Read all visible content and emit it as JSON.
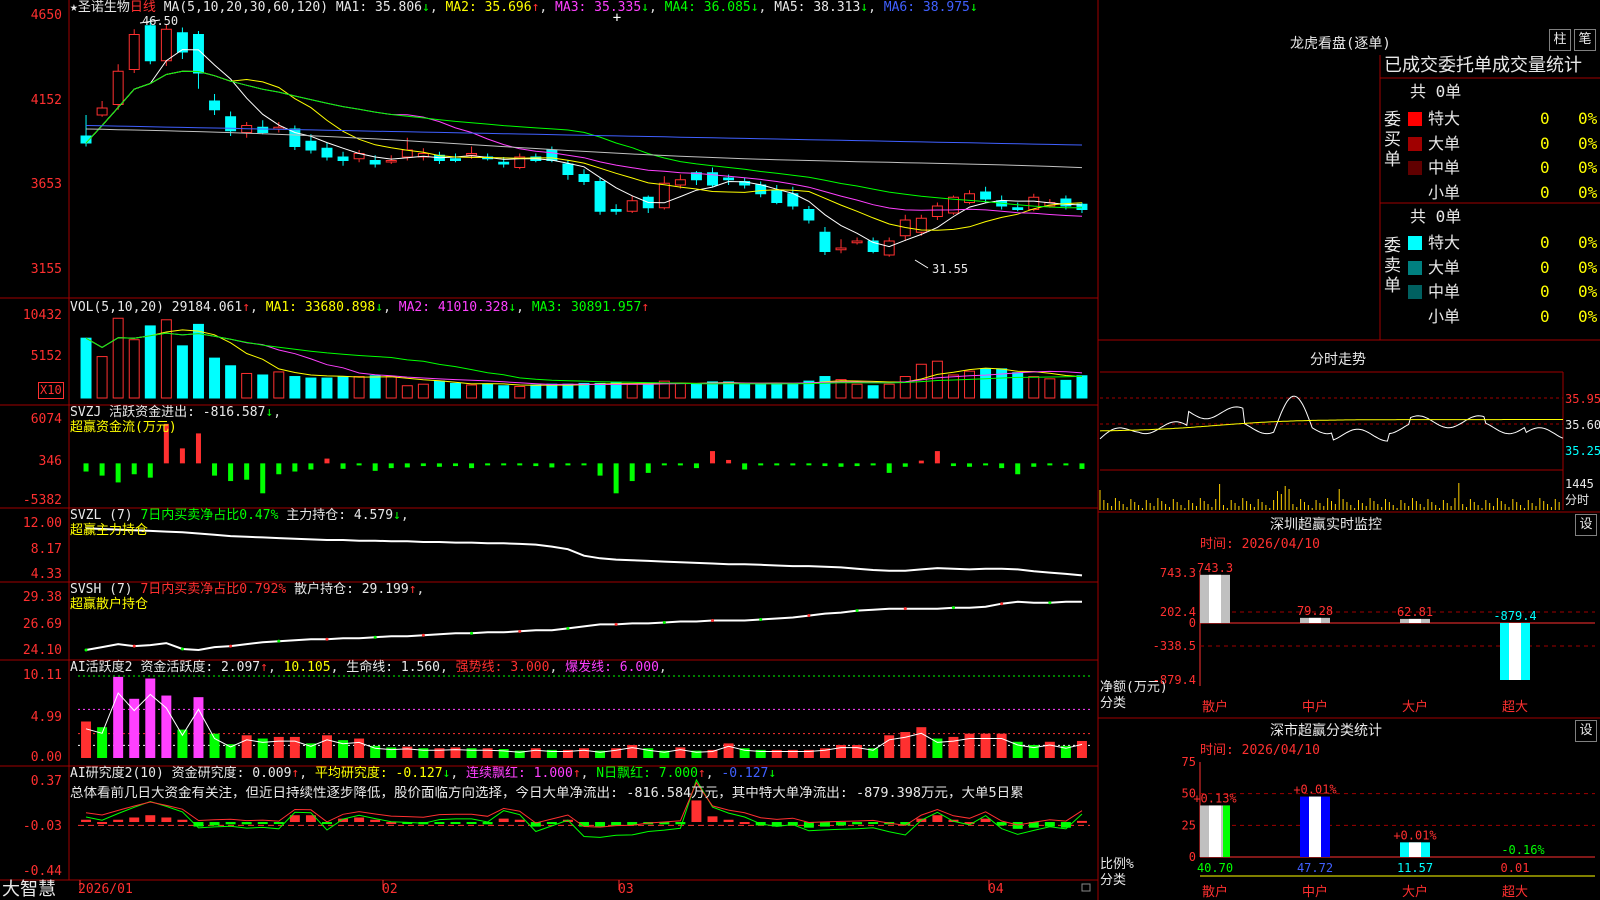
{
  "stock": {
    "name": "圣诺生物",
    "period": "日线",
    "star": "★"
  },
  "main_indicator": {
    "label": "MA(5,10,20,30,60,120)",
    "ma1": "MA1: 35.806",
    "ma2": "MA2: 35.696",
    "ma3": "MA3: 35.335",
    "ma4": "MA4: 36.085",
    "ma5": "MA5: 38.313",
    "ma6": "MA6: 38.975",
    "high_mark": "46.50",
    "low_mark": "31.55"
  },
  "vol_indicator": {
    "label": "VOL(5,10,20)",
    "value": "29184.061",
    "ma1": "MA1: 33680.898",
    "ma2": "MA2: 41010.328",
    "ma3": "MA3: 30891.957",
    "unit": "X10"
  },
  "svzj": {
    "label": "SVZJ",
    "line1": "活跃资金进出: -816.587",
    "line2": "超赢资金流(万元)"
  },
  "svzl": {
    "label": "SVZL (7)",
    "ratio": "7日内买卖净占比0.47%",
    "hold": "主力持仓: 4.579",
    "name": "超赢主力持仓"
  },
  "svsh": {
    "label": "SVSH (7)",
    "ratio": "7日内买卖净占比0.792%",
    "hold": "散户持仓: 29.199",
    "name": "超赢散户持仓"
  },
  "ai_active": {
    "label": "AI活跃度2",
    "act": "资金活跃度: 2.097",
    "v2": "10.105",
    "life": "生命线: 1.560",
    "strong": "强势线: 3.000",
    "burst": "爆发线: 6.000"
  },
  "ai_research": {
    "label": "AI研究度2(10)",
    "res": "资金研究度: 0.009",
    "avg": "平均研究度: -0.127",
    "red": "连续飘红: 1.000",
    "nred": "N日飘红: 7.000",
    "last": "-0.127"
  },
  "commentary": "总体看前几日大资金有关注，但近日持续性逐步降低，股价面临方向选择，今日大单净流出: -816.584万元，其中特大单净流出: -879.398万元，大单5日累",
  "axes": {
    "main": [
      "4650",
      "4152",
      "3653",
      "3155"
    ],
    "vol": [
      "10432",
      "5152"
    ],
    "svzj": [
      "6074",
      "346",
      "-5382"
    ],
    "svzl": [
      "12.00",
      "8.17",
      "4.33"
    ],
    "svsh": [
      "29.38",
      "26.69",
      "24.10"
    ],
    "ai1": [
      "10.11",
      "4.99",
      "0.00"
    ],
    "ai2": [
      "0.37",
      "-0.03",
      "-0.44"
    ],
    "dates": [
      "2026/01",
      "02",
      "03",
      "04"
    ]
  },
  "brand": "大智慧",
  "right": {
    "dragon_title": "龙虎看盘(逐单)",
    "btn_bar": "柱",
    "btn_pen": "笔",
    "stats_header": "已成交委托单成交量统计",
    "buy_label": "委买单",
    "sell_label": "委卖单",
    "buy_total": "共 0单",
    "sell_total": "共 0单",
    "buy_rows": [
      {
        "name": "特大",
        "count": "0",
        "pct": "0%",
        "color": "#ff0000"
      },
      {
        "name": "大单",
        "count": "0",
        "pct": "0%",
        "color": "#a00000"
      },
      {
        "name": "中单",
        "count": "0",
        "pct": "0%",
        "color": "#600000"
      },
      {
        "name": "小单",
        "count": "0",
        "pct": "0%",
        "color": "#000000"
      }
    ],
    "sell_rows": [
      {
        "name": "特大",
        "count": "0",
        "pct": "0%",
        "color": "#00ffff"
      },
      {
        "name": "大单",
        "count": "0",
        "pct": "0%",
        "color": "#008080"
      },
      {
        "name": "中单",
        "count": "0",
        "pct": "0%",
        "color": "#006060"
      },
      {
        "name": "小单",
        "count": "0",
        "pct": "0%",
        "color": "#000000"
      }
    ],
    "intraday_title": "分时走势",
    "intraday_prices": [
      "35.95",
      "35.60",
      "35.25"
    ],
    "intraday_vol": [
      "1445",
      "分时"
    ],
    "monitor_title": "深圳超赢实时监控",
    "monitor_time": "时间: 2026/04/10",
    "monitor_axis": [
      "743.3",
      "202.4",
      "0",
      "-338.5",
      "-879.4"
    ],
    "monitor_ylabel": "净额(万元)",
    "monitor_xlabel": "分类",
    "monitor_cats": [
      "散户",
      "中户",
      "大户",
      "超大"
    ],
    "monitor_values": [
      "743.3",
      "79.28",
      "62.81",
      "-879.4"
    ],
    "class_title": "深市超赢分类统计",
    "class_time": "时间: 2026/04/10",
    "class_axis": [
      "75",
      "50",
      "25",
      "0"
    ],
    "class_ylabel": "比例%",
    "class_xlabel": "分类",
    "class_cats": [
      "散户",
      "中户",
      "大户",
      "超大"
    ],
    "class_pcts": [
      "+0.13%",
      "+0.01%",
      "+0.01%",
      "-0.16%"
    ],
    "class_vals": [
      "40.70",
      "47.72",
      "11.57",
      "0.01"
    ],
    "btn_set": "设"
  },
  "chart_data": [
    {
      "type": "candlestick",
      "title": "圣诺生物 日线",
      "x_ticks": [
        "2026/01",
        "02",
        "03",
        "04"
      ],
      "ylim": [
        31.0,
        47.0
      ],
      "candles": [
        [
          39.8,
          39.4,
          41.0,
          39.2
        ],
        [
          41.0,
          41.4,
          41.8,
          40.9
        ],
        [
          41.6,
          43.5,
          43.9,
          41.3
        ],
        [
          43.6,
          45.6,
          45.9,
          43.4
        ],
        [
          46.1,
          44.1,
          46.5,
          43.9
        ],
        [
          44.1,
          45.9,
          46.2,
          43.8
        ],
        [
          45.7,
          44.6,
          46.0,
          44.2
        ],
        [
          45.6,
          43.4,
          45.8,
          42.5
        ],
        [
          41.8,
          41.3,
          42.2,
          41.0
        ],
        [
          40.9,
          40.1,
          41.2,
          39.8
        ],
        [
          40.0,
          40.4,
          40.6,
          39.7
        ],
        [
          40.3,
          40.0,
          40.7,
          39.9
        ],
        [
          40.2,
          40.3,
          40.6,
          40.0
        ],
        [
          40.2,
          39.2,
          40.4,
          39.0
        ],
        [
          39.5,
          39.0,
          39.9,
          38.8
        ],
        [
          39.1,
          38.6,
          39.4,
          38.4
        ],
        [
          38.6,
          38.4,
          38.9,
          38.1
        ],
        [
          38.5,
          38.8,
          39.0,
          38.3
        ],
        [
          38.4,
          38.2,
          38.7,
          38.0
        ],
        [
          38.4,
          38.4,
          38.7,
          38.2
        ],
        [
          38.6,
          39.0,
          39.7,
          38.4
        ],
        [
          38.6,
          38.8,
          39.1,
          38.4
        ],
        [
          38.7,
          38.4,
          38.9,
          38.2
        ],
        [
          38.5,
          38.4,
          38.8,
          38.3
        ],
        [
          38.7,
          38.8,
          39.2,
          38.5
        ],
        [
          38.6,
          38.5,
          38.8,
          38.4
        ],
        [
          38.3,
          38.2,
          38.6,
          38.0
        ],
        [
          38.0,
          38.6,
          38.8,
          37.9
        ],
        [
          38.6,
          38.4,
          38.8,
          38.3
        ],
        [
          39.0,
          38.4,
          39.2,
          38.3
        ],
        [
          38.2,
          37.6,
          38.4,
          37.3
        ],
        [
          37.6,
          37.2,
          37.9,
          37.0
        ],
        [
          37.2,
          35.5,
          37.4,
          35.3
        ],
        [
          35.6,
          35.5,
          35.9,
          35.3
        ],
        [
          35.5,
          36.1,
          36.4,
          35.4
        ],
        [
          36.3,
          35.7,
          36.4,
          35.4
        ],
        [
          35.7,
          37.1,
          37.5,
          35.6
        ],
        [
          37.0,
          37.3,
          37.6,
          36.8
        ],
        [
          37.7,
          37.3,
          37.8,
          37.0
        ],
        [
          37.7,
          37.0,
          38.0,
          36.9
        ],
        [
          37.4,
          37.3,
          37.6,
          37.0
        ],
        [
          37.2,
          37.0,
          37.4,
          36.8
        ],
        [
          37.0,
          36.5,
          37.2,
          36.3
        ],
        [
          36.7,
          36.0,
          37.0,
          35.9
        ],
        [
          36.5,
          35.8,
          36.9,
          35.6
        ],
        [
          35.6,
          35.0,
          35.8,
          34.8
        ],
        [
          34.3,
          33.2,
          34.6,
          33.0
        ],
        [
          33.3,
          33.4,
          33.9,
          33.1
        ],
        [
          33.7,
          33.8,
          34.0,
          33.6
        ],
        [
          33.8,
          33.2,
          34.0,
          33.1
        ],
        [
          33.0,
          33.8,
          34.0,
          32.9
        ],
        [
          34.1,
          35.0,
          35.3,
          33.8
        ],
        [
          34.3,
          35.1,
          35.3,
          34.1
        ],
        [
          35.2,
          35.8,
          36.0,
          35.0
        ],
        [
          35.4,
          36.3,
          36.4,
          35.3
        ],
        [
          36.0,
          36.5,
          36.7,
          35.9
        ],
        [
          36.6,
          36.2,
          36.9,
          36.0
        ],
        [
          36.1,
          35.8,
          36.4,
          35.6
        ],
        [
          35.7,
          35.6,
          36.0,
          35.5
        ],
        [
          35.6,
          36.3,
          36.5,
          35.5
        ],
        [
          35.8,
          36.0,
          36.2,
          35.7
        ],
        [
          36.2,
          35.8,
          36.4,
          35.6
        ],
        [
          35.9,
          35.6,
          36.0,
          35.4
        ]
      ],
      "series": [
        {
          "name": "MA1",
          "values": "computed MA5"
        },
        {
          "name": "MA2",
          "values": "computed MA10"
        }
      ]
    },
    {
      "type": "bar",
      "title": "VOL(5,10,20)",
      "ylim": [
        0,
        10432
      ],
      "values": [
        7800,
        5400,
        10400,
        7600,
        9400,
        10200,
        6800,
        9600,
        5200,
        4200,
        3200,
        3000,
        3400,
        2800,
        2600,
        2600,
        2800,
        2800,
        2900,
        2800,
        1600,
        1800,
        2200,
        1900,
        1700,
        1800,
        1600,
        1500,
        1700,
        1800,
        1800,
        1900,
        1900,
        2000,
        1800,
        1800,
        2200,
        1900,
        1800,
        2100,
        2100,
        1800,
        1800,
        1900,
        1900,
        2200,
        2800,
        2400,
        1800,
        1600,
        1800,
        2800,
        4400,
        4800,
        3000,
        3500,
        3800,
        3800,
        3300,
        2800,
        2500,
        2300,
        2900
      ]
    },
    {
      "type": "bar",
      "title": "超赢资金流(万元)",
      "ylim": [
        -5382,
        6074
      ],
      "values": [
        -1200,
        -1800,
        -2800,
        -1600,
        -2100,
        5800,
        2200,
        4400,
        -1800,
        -2600,
        -2400,
        -4400,
        -1600,
        -1200,
        -900,
        700,
        -800,
        -300,
        -1100,
        -700,
        -600,
        -400,
        -500,
        -400,
        -700,
        -300,
        -200,
        -300,
        -400,
        -600,
        -300,
        -200,
        -1800,
        -4400,
        -2600,
        -1400,
        -200,
        -300,
        -700,
        1800,
        500,
        -900,
        -300,
        -300,
        -300,
        -200,
        -400,
        -500,
        -400,
        -300,
        -1400,
        -500,
        400,
        1800,
        -400,
        -500,
        -300,
        -700,
        -1600,
        -500,
        -300,
        -300,
        -816
      ]
    },
    {
      "type": "line",
      "title": "超赢主力持仓",
      "ylim": [
        4.33,
        12.0
      ],
      "values": [
        11.8,
        11.7,
        11.6,
        11.5,
        11.4,
        11.3,
        11.2,
        11.0,
        10.8,
        10.6,
        10.5,
        10.4,
        10.3,
        10.2,
        10.1,
        10.0,
        10.0,
        9.9,
        9.9,
        9.8,
        9.8,
        9.7,
        9.7,
        9.6,
        9.6,
        9.5,
        9.5,
        9.4,
        9.3,
        9.0,
        8.6,
        7.6,
        7.2,
        7.0,
        6.9,
        6.8,
        6.7,
        6.6,
        6.5,
        6.4,
        6.3,
        6.3,
        6.2,
        6.1,
        6.0,
        6.0,
        5.9,
        5.8,
        5.6,
        5.4,
        5.3,
        5.3,
        5.5,
        5.7,
        5.6,
        5.5,
        5.6,
        5.6,
        5.5,
        5.2,
        5.0,
        4.8,
        4.58
      ]
    },
    {
      "type": "line",
      "title": "超赢散户持仓",
      "ylim": [
        24.1,
        29.38
      ],
      "values": [
        24.3,
        24.6,
        24.9,
        24.7,
        24.8,
        25.0,
        24.4,
        24.3,
        24.6,
        24.7,
        24.9,
        25.1,
        25.2,
        25.3,
        25.4,
        25.4,
        25.5,
        25.5,
        25.6,
        25.7,
        25.7,
        25.8,
        25.9,
        26.0,
        26.0,
        26.1,
        26.1,
        26.2,
        26.3,
        26.3,
        26.5,
        26.7,
        26.9,
        26.9,
        27.0,
        27.0,
        27.1,
        27.2,
        27.2,
        27.3,
        27.3,
        27.3,
        27.4,
        27.5,
        27.6,
        27.8,
        28.0,
        28.1,
        28.3,
        28.4,
        28.5,
        28.5,
        28.5,
        28.5,
        28.6,
        28.6,
        28.7,
        29.0,
        29.2,
        29.1,
        29.1,
        29.2,
        29.2
      ]
    },
    {
      "type": "bar",
      "title": "AI活跃度2",
      "ylim": [
        0,
        10.11
      ],
      "values": [
        4.5,
        3.8,
        10.0,
        7.3,
        9.8,
        7.7,
        3.5,
        7.5,
        3.0,
        1.7,
        2.8,
        2.4,
        2.6,
        2.6,
        1.8,
        2.8,
        2.2,
        2.4,
        1.5,
        1.3,
        1.4,
        1.2,
        1.2,
        1.3,
        1.2,
        1.2,
        1.1,
        0.9,
        1.2,
        1.0,
        1.0,
        1.2,
        0.9,
        1.2,
        1.6,
        1.2,
        0.9,
        1.3,
        0.9,
        1.0,
        1.8,
        1.2,
        1.0,
        1.0,
        1.0,
        1.0,
        1.2,
        1.6,
        1.6,
        1.2,
        2.8,
        3.2,
        3.8,
        2.4,
        2.6,
        3.0,
        3.0,
        3.0,
        2.0,
        1.6,
        2.0,
        1.5,
        2.1
      ],
      "colors_rule": "red=up, green=down, magenta=burst"
    },
    {
      "type": "bar",
      "title": "AI研究度2(10)",
      "ylim": [
        -0.44,
        0.37
      ],
      "values": [
        0.02,
        0.0,
        0.02,
        0.04,
        0.06,
        0.04,
        0.02,
        -0.04,
        -0.03,
        -0.02,
        -0.02,
        -0.01,
        -0.01,
        0.06,
        0.06,
        -0.01,
        0.03,
        0.04,
        0.02,
        0.0,
        -0.01,
        -0.02,
        -0.01,
        -0.01,
        -0.01,
        -0.02,
        0.03,
        0.02,
        -0.04,
        -0.01,
        0.02,
        -0.04,
        -0.04,
        -0.03,
        -0.03,
        -0.02,
        -0.02,
        -0.02,
        0.19,
        0.05,
        0.02,
        0.0,
        -0.03,
        -0.04,
        -0.03,
        -0.05,
        -0.04,
        -0.03,
        -0.02,
        -0.01,
        -0.02,
        -0.03,
        0.03,
        0.06,
        0.02,
        0.0,
        0.03,
        -0.03,
        -0.06,
        -0.05,
        -0.04,
        -0.05,
        0.01
      ]
    }
  ]
}
